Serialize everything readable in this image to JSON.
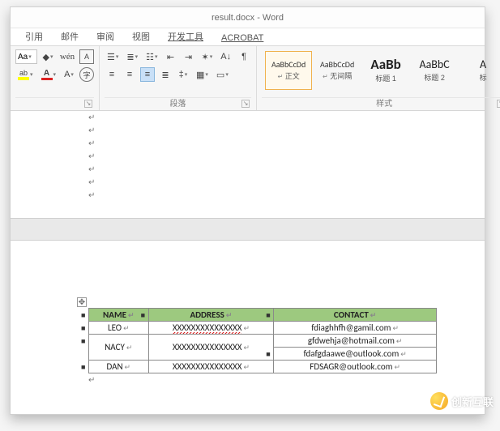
{
  "title": "result.docx - Word",
  "tabs": [
    "引用",
    "邮件",
    "审阅",
    "视图",
    "开发工具",
    "ACROBAT"
  ],
  "ribbon": {
    "font_group_label": "",
    "para_group_label": "段落",
    "styles_group_label": "样式",
    "font": {
      "name_placeholder": "Aa"
    },
    "styles": [
      {
        "preview": "AaBbCcDd",
        "name": "正文",
        "size": "10px",
        "color": "#333",
        "marker": true,
        "selected": true
      },
      {
        "preview": "AaBbCcDd",
        "name": "无间隔",
        "size": "10px",
        "color": "#333",
        "marker": true,
        "selected": false
      },
      {
        "preview": "AaBb",
        "name": "标题 1",
        "size": "17px",
        "color": "#222",
        "bold": true,
        "marker": false,
        "selected": false
      },
      {
        "preview": "AaBbC",
        "name": "标题 2",
        "size": "14px",
        "color": "#222",
        "marker": false,
        "selected": false
      },
      {
        "preview": "A",
        "name": "标",
        "size": "14px",
        "color": "#222",
        "marker": false,
        "selected": false
      }
    ]
  },
  "document": {
    "empty_paragraphs": 7,
    "table": {
      "headers": [
        "NAME",
        "ADDRESS",
        "CONTACT"
      ],
      "rows": [
        {
          "name": "LEO",
          "address": "XXXXXXXXXXXXXXX",
          "address_squiggle": true,
          "contacts": [
            "fdiaghhfh@gamil.com"
          ]
        },
        {
          "name": "NACY",
          "address": "XXXXXXXXXXXXXXX",
          "address_squiggle": false,
          "contacts": [
            "gfdwehja@hotmail.com",
            "fdafgdaawe@outlook.com"
          ]
        },
        {
          "name": "DAN",
          "address": "XXXXXXXXXXXXXXX",
          "address_squiggle": false,
          "contacts": [
            "FDSAGR@outlook.com"
          ]
        }
      ]
    }
  },
  "watermark": "创新互联"
}
